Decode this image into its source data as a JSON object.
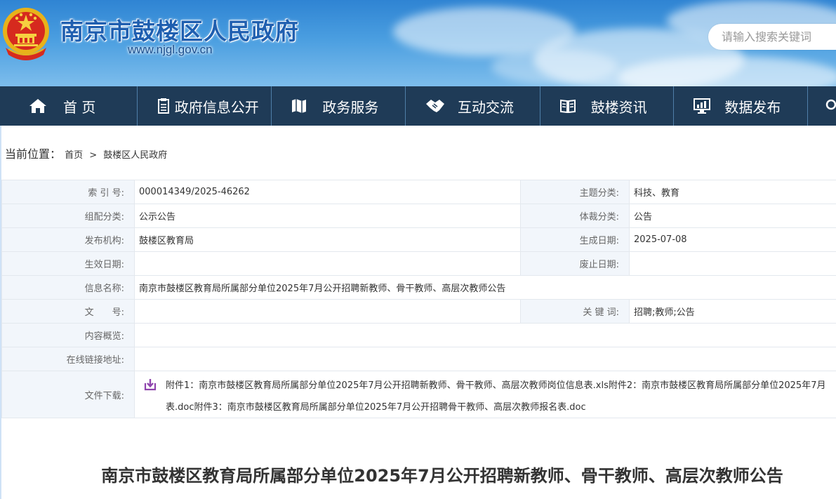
{
  "header": {
    "site_title": "南京市鼓楼区人民政府",
    "site_url": "www.njgl.gov.cn",
    "search_placeholder": "请输入搜索关键词"
  },
  "nav": {
    "items": [
      {
        "label": "首 页",
        "icon": "home-icon"
      },
      {
        "label": "政府信息公开",
        "icon": "document-icon"
      },
      {
        "label": "政务服务",
        "icon": "map-icon"
      },
      {
        "label": "互动交流",
        "icon": "handshake-icon"
      },
      {
        "label": "鼓楼资讯",
        "icon": "book-icon"
      },
      {
        "label": "数据发布",
        "icon": "monitor-icon"
      }
    ]
  },
  "breadcrumb": {
    "label": "当前位置：",
    "home": "首页",
    "separator": ">",
    "current": "鼓楼区人民政府"
  },
  "meta": {
    "index_label": "索 引 号:",
    "index_value": "000014349/2025-46262",
    "topic_label": "主题分类:",
    "topic_value": "科技、教育",
    "group_label": "组配分类:",
    "group_value": "公示公告",
    "genre_label": "体裁分类:",
    "genre_value": "公告",
    "org_label": "发布机构:",
    "org_value": "鼓楼区教育局",
    "created_label": "生成日期:",
    "created_value": "2025-07-08",
    "effective_label": "生效日期:",
    "effective_value": "",
    "expire_label": "废止日期:",
    "expire_value": "",
    "name_label": "信息名称:",
    "name_value": "南京市鼓楼区教育局所属部分单位2025年7月公开招聘新教师、骨干教师、高层次教师公告",
    "docno_label": "文　　号:",
    "docno_value": "",
    "keywords_label": "关 键 词:",
    "keywords_value": "招聘;教师;公告",
    "summary_label": "内容概览:",
    "summary_value": "",
    "link_label": "在线链接地址:",
    "link_value": "",
    "files_label": "文件下载:",
    "files_line1": "附件1：南京市鼓楼区教育局所属部分单位2025年7月公开招聘新教师、骨干教师、高层次教师岗位信息表.xls附件2：南京市鼓楼区教育局所属部分单位2025年7月",
    "files_line2": "表.doc附件3：南京市鼓楼区教育局所属部分单位2025年7月公开招聘骨干教师、高层次教师报名表.doc"
  },
  "article": {
    "title": "南京市鼓楼区教育局所属部分单位2025年7月公开招聘新教师、骨干教师、高层次教师公告"
  },
  "colors": {
    "nav_bg": "#1f3b57",
    "title_blue": "#1f5fb0",
    "download_icon": "#8e44ad"
  }
}
